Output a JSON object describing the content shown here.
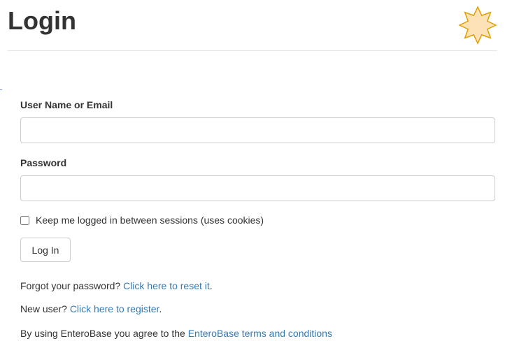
{
  "page": {
    "title": "Login"
  },
  "logo": {
    "icon": "star-icon",
    "fill_color": "#fde2b8",
    "stroke_color": "#e0a000"
  },
  "form": {
    "username_label": "User Name or Email",
    "username_value": "",
    "username_placeholder": "",
    "password_label": "Password",
    "password_value": "",
    "password_placeholder": "",
    "remember_label": "Keep me logged in between sessions (uses cookies)",
    "remember_checked": false,
    "login_button_label": "Log In"
  },
  "links": {
    "forgot_prefix": "Forgot your password? ",
    "forgot_link": "Click here to reset it",
    "forgot_suffix": ".",
    "register_prefix": "New user? ",
    "register_link": "Click here to register",
    "register_suffix": ".",
    "terms_prefix": "By using EnteroBase you agree to the ",
    "terms_link": "EnteroBase terms and conditions"
  },
  "colors": {
    "link": "#337ab7",
    "text": "#333333",
    "input_border": "#cccccc"
  }
}
